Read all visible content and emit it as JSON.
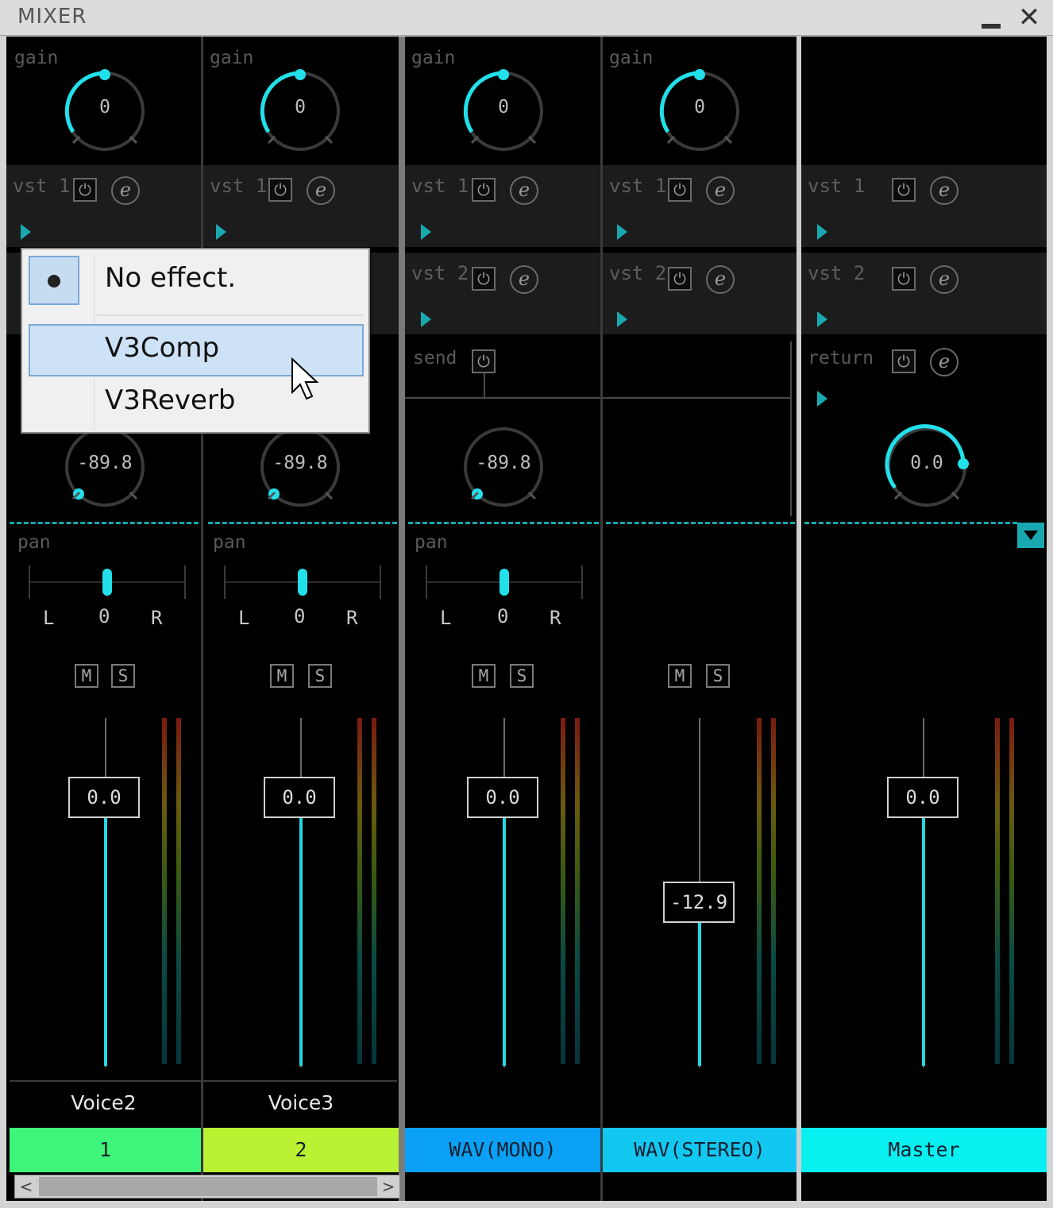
{
  "window": {
    "title": "MIXER",
    "minimize": "‗",
    "close": "✕"
  },
  "labels": {
    "gain": "gain",
    "send": "send",
    "return": "return",
    "pan": "pan",
    "L": "L",
    "R": "R",
    "M": "M",
    "S": "S",
    "power": "⏻",
    "edit": "e"
  },
  "channels": [
    {
      "gain": "0",
      "vst1": "vst 1",
      "send_value": "-89.8",
      "pan": "0",
      "fader": "0.0",
      "name": "Voice2",
      "bus": "1",
      "bus_color": "#3ef57a"
    },
    {
      "gain": "0",
      "vst1": "vst 1",
      "send_value": "-89.8",
      "pan": "0",
      "fader": "0.0",
      "name": "Voice3",
      "bus": "2",
      "bus_color": "#b8f232"
    },
    {
      "gain": "0",
      "vst1": "vst 1",
      "vst2": "vst 2",
      "send": "send",
      "send_value": "-89.8",
      "pan": "0",
      "fader": "0.0",
      "name": "",
      "bus": "WAV(MONO)",
      "bus_color": "#0aa0f5"
    },
    {
      "gain": "0",
      "vst1": "vst 1",
      "vst2": "vst 2",
      "fader": "-12.9",
      "name": "",
      "bus": "WAV(STEREO)",
      "bus_color": "#12c8f0"
    },
    {
      "vst1": "vst 1",
      "vst2": "vst 2",
      "return": "return",
      "return_value": "0.0",
      "fader": "0.0",
      "name": "",
      "bus": "Master",
      "bus_color": "#08f0f0"
    }
  ],
  "menu": {
    "items": [
      "No effect.",
      "V3Comp",
      "V3Reverb"
    ],
    "selected": "No effect.",
    "hovered": "V3Comp"
  },
  "scrollbar": {
    "left": "<",
    "right": ">"
  },
  "colors": {
    "accent": "#22e0ea",
    "background": "#000000"
  }
}
